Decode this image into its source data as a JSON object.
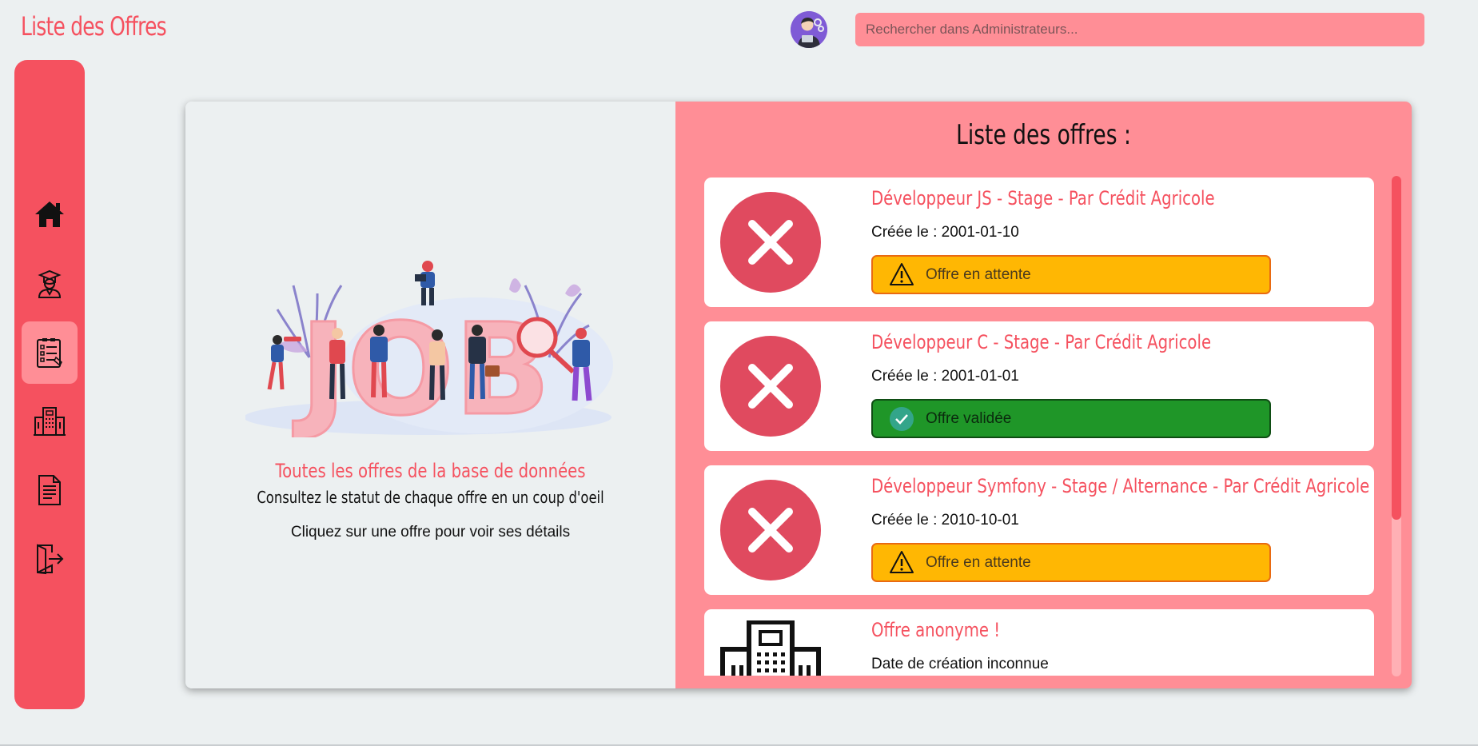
{
  "header": {
    "title": "Liste des Offres",
    "search_placeholder": "Rechercher dans Administrateurs..."
  },
  "sidebar": {
    "items": [
      {
        "name": "home",
        "icon": "home-icon",
        "active": false
      },
      {
        "name": "students",
        "icon": "graduate-user-icon",
        "active": false
      },
      {
        "name": "offers",
        "icon": "checklist-icon",
        "active": true
      },
      {
        "name": "companies",
        "icon": "building-icon",
        "active": false
      },
      {
        "name": "documents",
        "icon": "document-icon",
        "active": false
      },
      {
        "name": "logout",
        "icon": "logout-icon",
        "active": false
      }
    ]
  },
  "left_panel": {
    "title": "Toutes les offres de la base de données",
    "subtitle": "Consultez le statut de chaque offre en un coup d'oeil",
    "hint": "Cliquez sur une offre pour voir ses détails",
    "illustration_text": "JOB"
  },
  "right_panel": {
    "title": "Liste des offres :",
    "offers": [
      {
        "title": "Développeur JS - Stage - Par Crédit Agricole",
        "date": "Créée le : 2001-01-10",
        "status": "Offre en attente",
        "status_type": "pending",
        "icon": "close-circle-icon"
      },
      {
        "title": "Développeur C - Stage - Par Crédit Agricole",
        "date": "Créée le : 2001-01-01",
        "status": "Offre validée",
        "status_type": "valid",
        "icon": "close-circle-icon"
      },
      {
        "title": "Développeur Symfony - Stage / Alternance - Par Crédit Agricole",
        "date": "Créée le : 2010-10-01",
        "status": "Offre en attente",
        "status_type": "pending",
        "icon": "close-circle-icon"
      },
      {
        "title": "Offre anonyme !",
        "date": "Date de création inconnue",
        "status": "",
        "status_type": "none",
        "icon": "building-icon"
      }
    ]
  },
  "colors": {
    "accent": "#f5515f",
    "accent_light": "#ff8e96",
    "pending": "#ffb703",
    "valid": "#1f9628",
    "reject_circle": "#e04a5f",
    "background": "#ecf0f1"
  }
}
